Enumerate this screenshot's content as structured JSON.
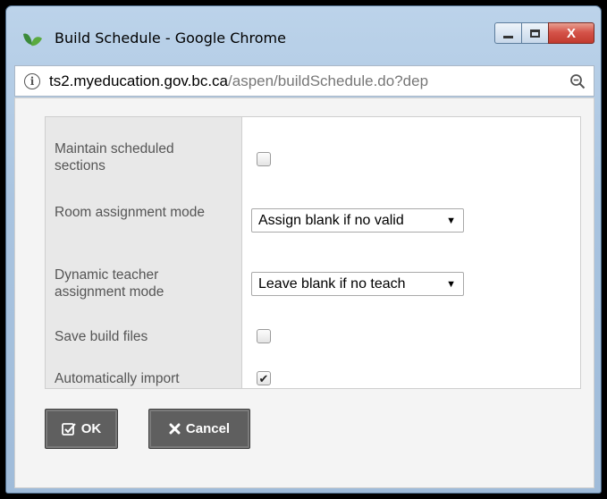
{
  "window": {
    "title": "Build Schedule - Google Chrome",
    "controls": {
      "minimize_icon": "minimize-icon",
      "maximize_icon": "maximize-icon",
      "close_glyph": "X"
    }
  },
  "addressbar": {
    "info_glyph": "i",
    "url_host": "ts2.myeducation.gov.bc.ca",
    "url_path": "/aspen/buildSchedule.do?dep"
  },
  "form": {
    "maintain_label": "Maintain scheduled sections",
    "maintain_checked": false,
    "room_label": "Room assignment mode",
    "room_value": "Assign blank if no valid",
    "teacher_label": "Dynamic teacher assignment mode",
    "teacher_value": "Leave blank if no teach",
    "save_label": "Save build files",
    "save_checked": false,
    "import_label": "Automatically import",
    "import_checked": true,
    "select_arrow": "▼",
    "check_glyph": "✔"
  },
  "buttons": {
    "ok_label": "OK",
    "ok_icon": "check-square-icon",
    "cancel_label": "Cancel",
    "cancel_icon": "x-icon"
  },
  "colors": {
    "button_bg": "#5f5f5f",
    "label_col_bg": "#e8e8e8",
    "close_red": "#c23a2e"
  }
}
